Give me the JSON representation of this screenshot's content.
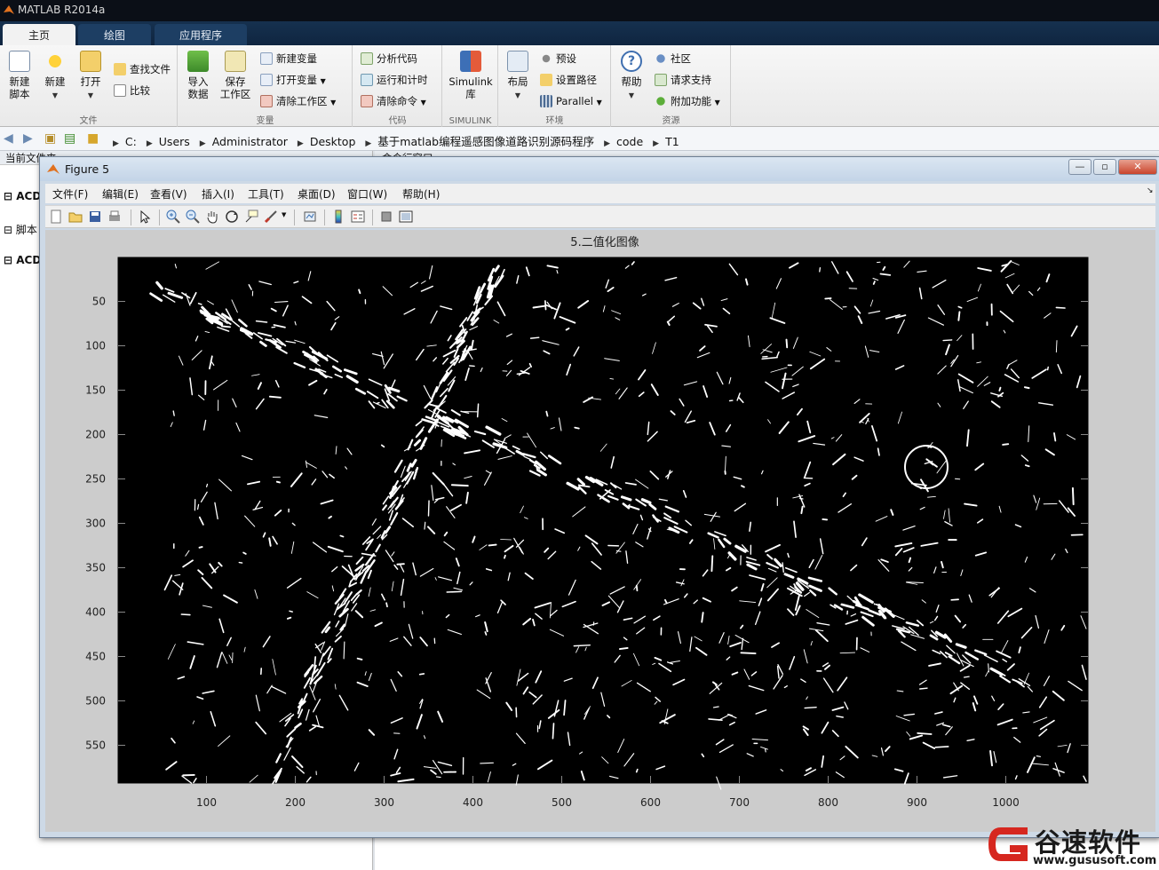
{
  "app": {
    "title": "MATLAB R2014a",
    "tabs": [
      "主页",
      "绘图",
      "应用程序"
    ]
  },
  "ribbon": {
    "file": {
      "label": "文件",
      "new_script": [
        "新建",
        "脚本"
      ],
      "new": "新建",
      "open": "打开",
      "find_files": "查找文件",
      "compare": "比较"
    },
    "variable": {
      "label": "变量",
      "import": [
        "导入",
        "数据"
      ],
      "save": [
        "保存",
        "工作区"
      ],
      "new_var": "新建变量",
      "open_var": "打开变量",
      "clear_ws": "清除工作区"
    },
    "code": {
      "label": "代码",
      "analyze": "分析代码",
      "run_time": "运行和计时",
      "clear_cmd": "清除命令"
    },
    "simulink": {
      "label": "SIMULINK",
      "lib": [
        "Simulink",
        "库"
      ]
    },
    "env": {
      "label": "环境",
      "layout": "布局",
      "prefs": "预设",
      "set_path": "设置路径",
      "parallel": "Parallel"
    },
    "resources": {
      "label": "资源",
      "help": "帮助",
      "community": "社区",
      "support": "请求支持",
      "addons": "附加功能"
    }
  },
  "address": {
    "crumbs": [
      "C:",
      "Users",
      "Administrator",
      "Desktop",
      "基于matlab编程遥感图像道路识别源码程序",
      "code",
      "T1"
    ]
  },
  "panels": {
    "left_header": "当前文件夹",
    "right_header": "命令行窗口",
    "tree": [
      "ACD",
      "脚本",
      "ACD"
    ]
  },
  "figure": {
    "title": "Figure 5",
    "menus": [
      "文件(F)",
      "编辑(E)",
      "查看(V)",
      "插入(I)",
      "工具(T)",
      "桌面(D)",
      "窗口(W)",
      "帮助(H)"
    ],
    "toolbar_icons": [
      "new-figure-icon",
      "open-file-icon",
      "save-icon",
      "print-icon",
      "select-arrow-icon",
      "zoom-in-icon",
      "zoom-out-icon",
      "pan-hand-icon",
      "rotate-icon",
      "data-cursor-icon",
      "brush-icon",
      "link-plot-icon",
      "colorbar-icon",
      "legend-icon",
      "hide-plot-tools-icon",
      "show-plot-tools-icon"
    ]
  },
  "plot": {
    "title": "5.二值化图像",
    "x_ticks": [
      "100",
      "200",
      "300",
      "400",
      "500",
      "600",
      "700",
      "800",
      "900",
      "1000"
    ],
    "y_ticks": [
      "50",
      "100",
      "150",
      "200",
      "250",
      "300",
      "350",
      "400",
      "450",
      "500",
      "550"
    ],
    "xlim": [
      0.5,
      1092.5
    ],
    "ylim": [
      0.5,
      592.5
    ],
    "colormap": [
      "#000000",
      "#ffffff"
    ]
  },
  "watermark": {
    "brand": "谷速软件",
    "url": "www.gususoft.com"
  }
}
